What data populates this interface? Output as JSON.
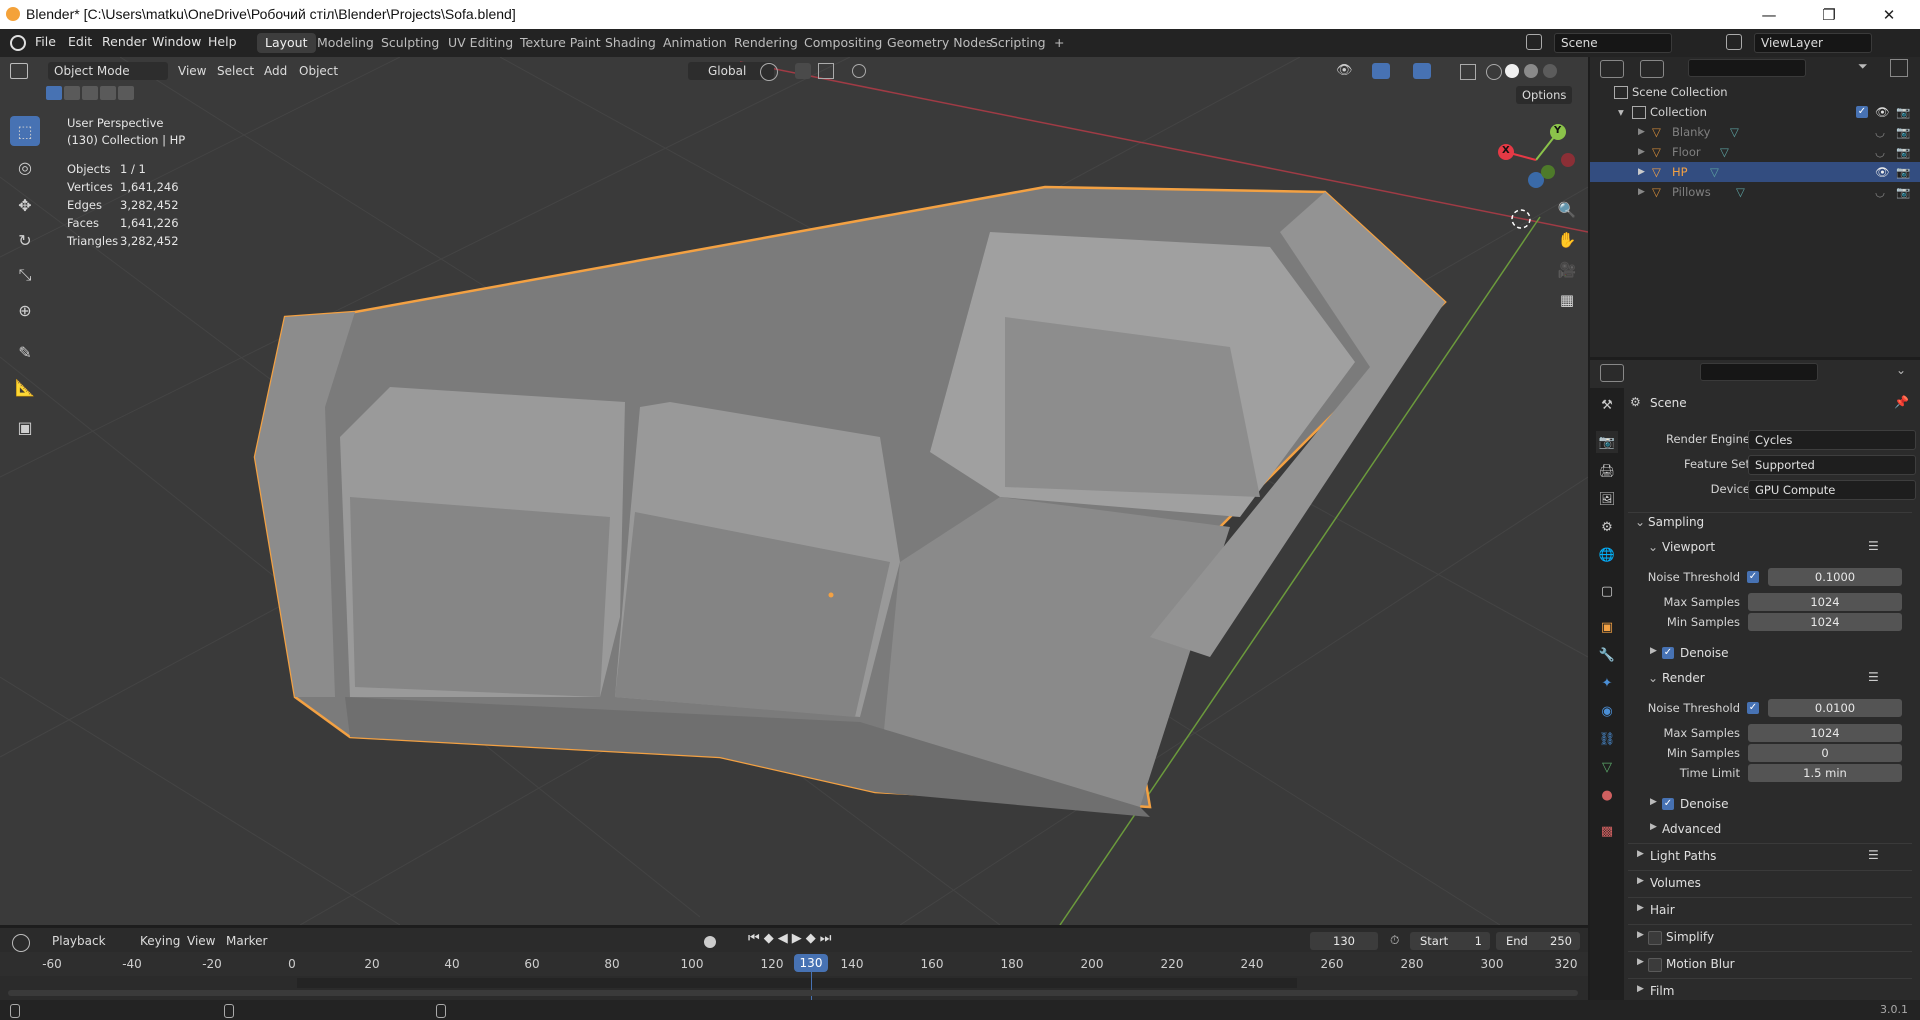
{
  "window": {
    "title": "Blender* [C:\\Users\\matku\\OneDrive\\Робочий стіл\\Blender\\Projects\\Sofa.blend]",
    "minimize": "—",
    "maximize": "❐",
    "close": "✕"
  },
  "menus": [
    "File",
    "Edit",
    "Render",
    "Window",
    "Help"
  ],
  "workspaces": [
    "Layout",
    "Modeling",
    "Sculpting",
    "UV Editing",
    "Texture Paint",
    "Shading",
    "Animation",
    "Rendering",
    "Compositing",
    "Geometry Nodes",
    "Scripting",
    "+"
  ],
  "active_workspace": "Layout",
  "scene_name": "Scene",
  "view_layer": "ViewLayer",
  "viewport_header": {
    "mode": "Object Mode",
    "view": "View",
    "select": "Select",
    "add": "Add",
    "object": "Object",
    "transform_orientation": "Global",
    "options": "Options"
  },
  "viewport_info": {
    "perspective": "User Perspective",
    "collection": "(130) Collection | HP",
    "stats": [
      {
        "label": "Objects",
        "value": "1 / 1"
      },
      {
        "label": "Vertices",
        "value": "1,641,246"
      },
      {
        "label": "Edges",
        "value": "3,282,452"
      },
      {
        "label": "Faces",
        "value": "1,641,226"
      },
      {
        "label": "Triangles",
        "value": "3,282,452"
      }
    ]
  },
  "gizmo": {
    "x": "X",
    "y": "Y"
  },
  "outliner": {
    "root": "Scene Collection",
    "collection": "Collection",
    "items": [
      {
        "name": "Blanky",
        "selected": false
      },
      {
        "name": "Floor",
        "selected": false
      },
      {
        "name": "HP",
        "selected": true
      },
      {
        "name": "Pillows",
        "selected": false
      }
    ]
  },
  "properties": {
    "context": "Scene",
    "render_engine_label": "Render Engine",
    "render_engine": "Cycles",
    "feature_set_label": "Feature Set",
    "feature_set": "Supported",
    "device_label": "Device",
    "device": "GPU Compute",
    "sampling": "Sampling",
    "viewport": "Viewport",
    "viewport_noise_label": "Noise Threshold",
    "viewport_noise": "0.1000",
    "viewport_max_label": "Max Samples",
    "viewport_max": "1024",
    "viewport_min_label": "Min Samples",
    "viewport_min": "1024",
    "denoise": "Denoise",
    "render": "Render",
    "render_noise_label": "Noise Threshold",
    "render_noise": "0.0100",
    "render_max_label": "Max Samples",
    "render_max": "1024",
    "render_min_label": "Min Samples",
    "render_min": "0",
    "time_limit_label": "Time Limit",
    "time_limit": "1.5 min",
    "denoise2": "Denoise",
    "advanced": "Advanced",
    "light_paths": "Light Paths",
    "volumes": "Volumes",
    "hair": "Hair",
    "simplify": "Simplify",
    "motion_blur": "Motion Blur",
    "film": "Film"
  },
  "timeline": {
    "playback": "Playback",
    "keying": "Keying",
    "view": "View",
    "marker": "Marker",
    "current_frame": "130",
    "start_label": "Start",
    "start": "1",
    "end_label": "End",
    "end": "250",
    "ticks": [
      "-60",
      "-40",
      "-20",
      "0",
      "20",
      "40",
      "60",
      "80",
      "100",
      "120",
      "140",
      "160",
      "180",
      "200",
      "220",
      "240",
      "260",
      "280",
      "300",
      "320"
    ],
    "playhead": "130"
  },
  "version": "3.0.1",
  "colors": {
    "accent": "#4772b3",
    "selection_outline": "#f3a143",
    "viewport_bg": "#3a3a3a"
  }
}
